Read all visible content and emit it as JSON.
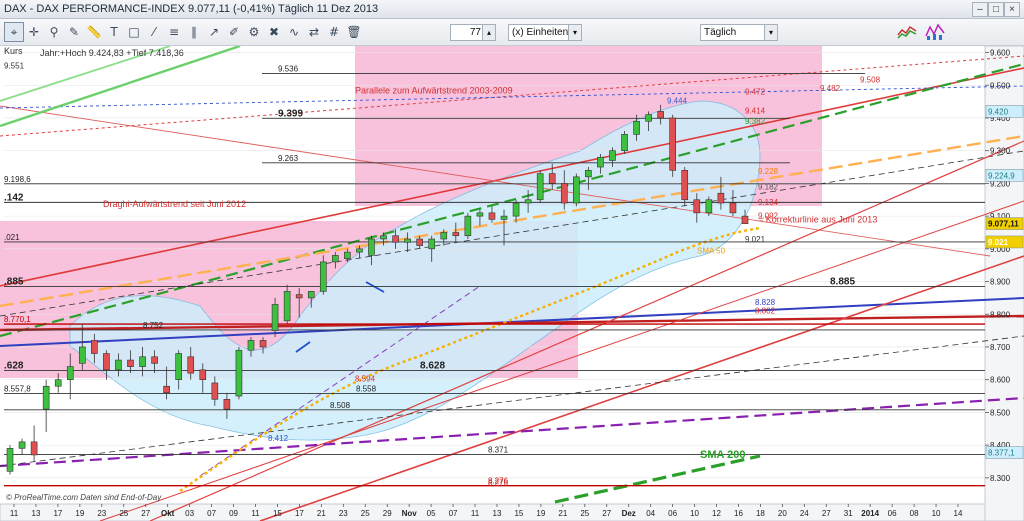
{
  "window": {
    "title": "DAX - DAX PERFORMANCE-INDEX     9.077,11 (-0,41%)     Täglich  11 Dez 2013",
    "controls": [
      "–",
      "□",
      "×"
    ]
  },
  "toolbar": {
    "icons": [
      "cursor-icon",
      "crosshair-icon",
      "zoom-icon",
      "pencil-icon",
      "ruler-icon",
      "text-icon",
      "shapes-icon",
      "trendline-icon",
      "fibonacci-icon",
      "channel-icon",
      "arrow-icon",
      "brush-icon",
      "settings-icon",
      "delete-icon",
      "indicator-icon",
      "compare-icon",
      "template-icon",
      "gear-icon",
      "grid-icon",
      "print-icon",
      "save-icon",
      "trash-icon"
    ],
    "periods_value": "77",
    "units_label": "(x) Einheiten",
    "interval_value": "Täglich"
  },
  "header": {
    "kurs_label": "Kurs",
    "high_low": "Jahr:+Hoch 9.424,83 +Tief 7.418,36"
  },
  "colors": {
    "up": "#3fbf3f",
    "down": "#e05050",
    "pink_zone": "#f7b7d6",
    "blue_zone": "#cdeefc",
    "price_tag": "#f2d000"
  },
  "chart_data": {
    "type": "candlestick",
    "ylim": [
      8220,
      9620
    ],
    "y_ticks": [
      "9.600",
      "9.500",
      "9.400",
      "9.300",
      "9.200",
      "9.100",
      "9.000",
      "8.900",
      "8.800",
      "8.700",
      "8.600",
      "8.500",
      "8.400",
      "8.300"
    ],
    "y_tick_values": [
      9600,
      9500,
      9400,
      9300,
      9200,
      9100,
      9000,
      8900,
      8800,
      8700,
      8600,
      8500,
      8400,
      8300
    ],
    "x_tick_labels": [
      "11",
      "13",
      "17",
      "19",
      "23",
      "25",
      "27",
      "Okt",
      "03",
      "07",
      "09",
      "11",
      "15",
      "17",
      "21",
      "23",
      "25",
      "29",
      "Nov",
      "05",
      "07",
      "11",
      "13",
      "15",
      "19",
      "21",
      "25",
      "27",
      "Dez",
      "04",
      "06",
      "10",
      "12",
      "16",
      "18",
      "20",
      "24",
      "27",
      "31",
      "2014",
      "06",
      "08",
      "10",
      "14"
    ],
    "x_tick_bold": [
      "Okt",
      "Nov",
      "Dez",
      "2014"
    ],
    "candles": [
      [
        8320,
        8400,
        8310,
        8390
      ],
      [
        8390,
        8420,
        8370,
        8410
      ],
      [
        8410,
        8460,
        8350,
        8370
      ],
      [
        8510,
        8600,
        8440,
        8580
      ],
      [
        8580,
        8620,
        8560,
        8600
      ],
      [
        8600,
        8680,
        8540,
        8640
      ],
      [
        8650,
        8770,
        8630,
        8700
      ],
      [
        8720,
        8740,
        8650,
        8680
      ],
      [
        8680,
        8690,
        8600,
        8630
      ],
      [
        8630,
        8680,
        8610,
        8660
      ],
      [
        8660,
        8690,
        8620,
        8640
      ],
      [
        8640,
        8700,
        8610,
        8670
      ],
      [
        8670,
        8690,
        8620,
        8650
      ],
      [
        8580,
        8640,
        8540,
        8560
      ],
      [
        8600,
        8690,
        8570,
        8680
      ],
      [
        8670,
        8700,
        8600,
        8620
      ],
      [
        8630,
        8650,
        8560,
        8600
      ],
      [
        8590,
        8610,
        8520,
        8540
      ],
      [
        8540,
        8560,
        8480,
        8510
      ],
      [
        8550,
        8700,
        8540,
        8690
      ],
      [
        8690,
        8730,
        8670,
        8720
      ],
      [
        8720,
        8730,
        8680,
        8700
      ],
      [
        8750,
        8850,
        8730,
        8830
      ],
      [
        8780,
        8890,
        8770,
        8870
      ],
      [
        8860,
        8880,
        8790,
        8850
      ],
      [
        8850,
        8870,
        8820,
        8870
      ],
      [
        8870,
        8980,
        8860,
        8960
      ],
      [
        8960,
        8990,
        8940,
        8980
      ],
      [
        8970,
        9000,
        8960,
        8990
      ],
      [
        8990,
        9010,
        8970,
        9000
      ],
      [
        8980,
        9040,
        8950,
        9030
      ],
      [
        9030,
        9050,
        9010,
        9040
      ],
      [
        9040,
        9060,
        9000,
        9020
      ],
      [
        9020,
        9050,
        8990,
        9030
      ],
      [
        9030,
        9040,
        9000,
        9010
      ],
      [
        9000,
        9040,
        8960,
        9030
      ],
      [
        9030,
        9060,
        9010,
        9050
      ],
      [
        9050,
        9080,
        9020,
        9040
      ],
      [
        9040,
        9110,
        9030,
        9100
      ],
      [
        9100,
        9120,
        9070,
        9110
      ],
      [
        9110,
        9130,
        9080,
        9090
      ],
      [
        9090,
        9120,
        9010,
        9100
      ],
      [
        9100,
        9150,
        9080,
        9140
      ],
      [
        9140,
        9180,
        9110,
        9150
      ],
      [
        9150,
        9240,
        9140,
        9230
      ],
      [
        9230,
        9260,
        9180,
        9200
      ],
      [
        9200,
        9240,
        9120,
        9140
      ],
      [
        9140,
        9230,
        9130,
        9220
      ],
      [
        9220,
        9250,
        9180,
        9240
      ],
      [
        9250,
        9290,
        9230,
        9280
      ],
      [
        9270,
        9310,
        9250,
        9300
      ],
      [
        9300,
        9360,
        9290,
        9350
      ],
      [
        9350,
        9410,
        9330,
        9390
      ],
      [
        9390,
        9420,
        9360,
        9410
      ],
      [
        9420,
        9440,
        9380,
        9400
      ],
      [
        9400,
        9410,
        9220,
        9240
      ],
      [
        9240,
        9250,
        9130,
        9150
      ],
      [
        9150,
        9170,
        9080,
        9110
      ],
      [
        9110,
        9160,
        9100,
        9150
      ],
      [
        9170,
        9220,
        9120,
        9140
      ],
      [
        9140,
        9180,
        9100,
        9110
      ],
      [
        9100,
        9120,
        9080,
        9077
      ]
    ],
    "horizontal_levels": [
      {
        "label": "9.536",
        "value": 9536,
        "color": "#333333"
      },
      {
        "label": "9.399",
        "value": 9399,
        "color": "#333333"
      },
      {
        "label": "9.263",
        "value": 9263,
        "color": "#333333"
      },
      {
        "label": "9.198,6",
        "value": 9198.6,
        "color": "#333333"
      },
      {
        "label": ".142",
        "value": 9142,
        "color": "#333333"
      },
      {
        "label": ".021",
        "value": 9021,
        "color": "#333333"
      },
      {
        "label": ".885",
        "value": 8885,
        "color": "#333333"
      },
      {
        "label": "8.885",
        "value": 8885,
        "color": "#333333"
      },
      {
        "label": "8.770,1",
        "value": 8770,
        "color": "#c00000"
      },
      {
        "label": "8.752",
        "value": 8752,
        "color": "#333333"
      },
      {
        "label": ".628",
        "value": 8628,
        "color": "#333333"
      },
      {
        "label": "8.628",
        "value": 8628,
        "color": "#333333"
      },
      {
        "label": "8.557,8",
        "value": 8558,
        "color": "#333333"
      },
      {
        "label": "8.558",
        "value": 8558,
        "color": "#333333"
      },
      {
        "label": "8.508",
        "value": 8508,
        "color": "#333333"
      },
      {
        "label": "8.371",
        "value": 8371,
        "color": "#333333"
      },
      {
        "label": "8.276",
        "value": 8276,
        "color": "#c00000"
      }
    ],
    "annotations": [
      {
        "text": "9.551",
        "value": 9551,
        "color": "#333333"
      },
      {
        "text": "Parallele zum Aufwärtstrend 2003-2009",
        "value": 9475,
        "color": "#d03030"
      },
      {
        "text": "9.444",
        "value": 9444,
        "color": "#3060d0"
      },
      {
        "text": "9.472",
        "value": 9472,
        "color": "#d03030"
      },
      {
        "text": "9.414",
        "value": 9414,
        "color": "#d03030"
      },
      {
        "text": "9.382",
        "value": 9382,
        "color": "#2aa02a"
      },
      {
        "text": "9.508",
        "value": 9508,
        "color": "#d03030"
      },
      {
        "text": "9.482",
        "value": 9482,
        "color": "#d03030"
      },
      {
        "text": "9.228",
        "value": 9228,
        "color": "#f08000"
      },
      {
        "text": "9.182",
        "value": 9182,
        "color": "#555555"
      },
      {
        "text": "9.134",
        "value": 9134,
        "color": "#d03030"
      },
      {
        "text": "9.092",
        "value": 9092,
        "color": "#d03030"
      },
      {
        "text": "= Korrekturlinie aus Juni 2013",
        "value": 9080,
        "color": "#d03030"
      },
      {
        "text": "9.021",
        "value": 9021,
        "color": "#333333"
      },
      {
        "text": "SMA 50",
        "value": 8985,
        "color": "#f0a000"
      },
      {
        "text": "8.828",
        "value": 8828,
        "color": "#3040c0"
      },
      {
        "text": "8.802",
        "value": 8802,
        "color": "#d03030"
      },
      {
        "text": "Draghi-Aufwärtstrend seit Juni 2012",
        "value": 9128,
        "color": "#d03030"
      },
      {
        "text": "8.594",
        "value": 8594,
        "color": "#d03030"
      },
      {
        "text": "8.412",
        "value": 8412,
        "color": "#3050d0"
      },
      {
        "text": "SMA 200",
        "value": 8360,
        "color": "#2aa02a"
      },
      {
        "text": "8.276",
        "value": 8276,
        "color": "#d03030"
      }
    ],
    "price_tags": [
      {
        "text": "9.420",
        "value": 9420,
        "bg": "#cdeefc",
        "fg": "#208080"
      },
      {
        "text": "9.224,9",
        "value": 9224.9,
        "bg": "#cdeefc",
        "fg": "#208080"
      },
      {
        "text": "9.077,11",
        "value": 9077.11,
        "bg": "#f2d000",
        "fg": "#111111"
      },
      {
        "text": "9.021",
        "value": 9021,
        "bg": "#f2d000",
        "fg": "#ffffff"
      },
      {
        "text": "8.377,1",
        "value": 8377.1,
        "bg": "#cdeefc",
        "fg": "#208080"
      }
    ],
    "footer": "© ProRealTime.com  Daten sind End-of-Day"
  }
}
